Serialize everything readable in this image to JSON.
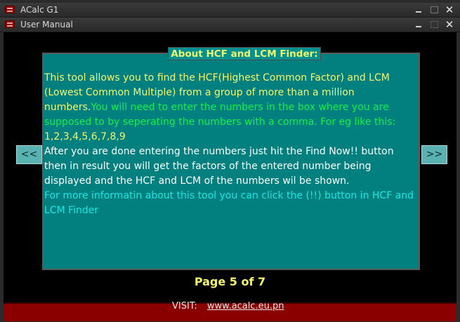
{
  "window1": {
    "title": "ACalc G1"
  },
  "window2": {
    "title": "User Manual"
  },
  "manual": {
    "heading": "About HCF and LCM Finder:",
    "intro": "This tool allows you to find the HCF(Highest Common Factor) and LCM (Lowest Common Multiple) from a group of more than a million numbers.",
    "instruction": "You will need to enter the numbers in the box where you are supposed to by seperating the numbers with a comma. For eg like this:",
    "example": " 1,2,3,4,5,6,7,8,9",
    "after": "After you are done entering the numbers just hit the Find Now!! button then in result you will get the factors of the entered number being displayed and the HCF and LCM of the numbers wil be shown.",
    "more_info": " For more informatin about this tool you can click the (!!) button in HCF and LCM Finder"
  },
  "nav": {
    "prev_label": "<<",
    "next_label": ">>",
    "page_indicator": "Page 5 of 7"
  },
  "footer": {
    "visit_label": "VISIT:",
    "link": "www.acalc.eu.pn"
  },
  "colors": {
    "panel": "#028080",
    "heading_text": "#f5f56b",
    "intro_text": "#f5f56b",
    "instruction_text": "#12f04a",
    "body_text": "#ffffff",
    "info_text": "#19e8e0",
    "footer_bg": "#8a0000"
  },
  "icons": [
    "app-icon",
    "minimize-icon",
    "maximize-icon",
    "close-icon"
  ]
}
